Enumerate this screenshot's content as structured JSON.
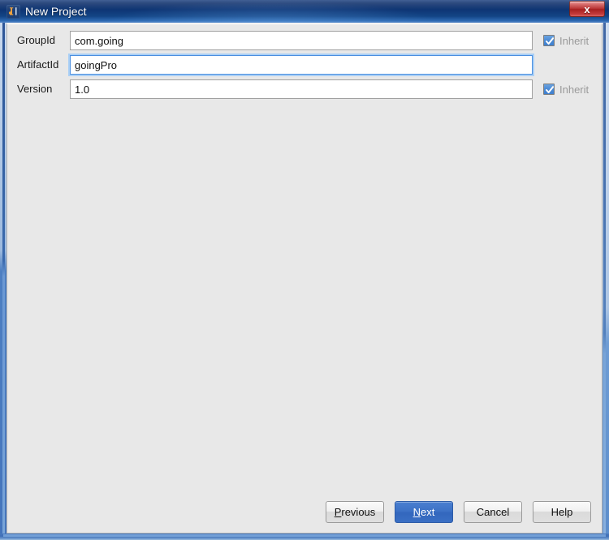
{
  "window": {
    "title": "New Project",
    "app_icon": "intellij-idea-icon",
    "close_label": "x",
    "background_color": "#e8e8e8",
    "titlebar_color": "#12376f",
    "accent_color": "#3d72c6"
  },
  "form": {
    "rows": [
      {
        "label": "GroupId",
        "value": "com.going",
        "focused": false,
        "inherit": {
          "label": "Inherit",
          "checked": true,
          "enabled": false
        }
      },
      {
        "label": "ArtifactId",
        "value": "goingPro",
        "focused": true,
        "inherit": null
      },
      {
        "label": "Version",
        "value": "1.0",
        "focused": false,
        "inherit": {
          "label": "Inherit",
          "checked": true,
          "enabled": false
        }
      }
    ]
  },
  "buttons": {
    "previous": {
      "label": "Previous",
      "mnemonic": "P",
      "default": false
    },
    "next": {
      "label": "Next",
      "mnemonic": "N",
      "default": true
    },
    "cancel": {
      "label": "Cancel",
      "mnemonic": "",
      "default": false
    },
    "help": {
      "label": "Help",
      "mnemonic": "",
      "default": false
    }
  }
}
